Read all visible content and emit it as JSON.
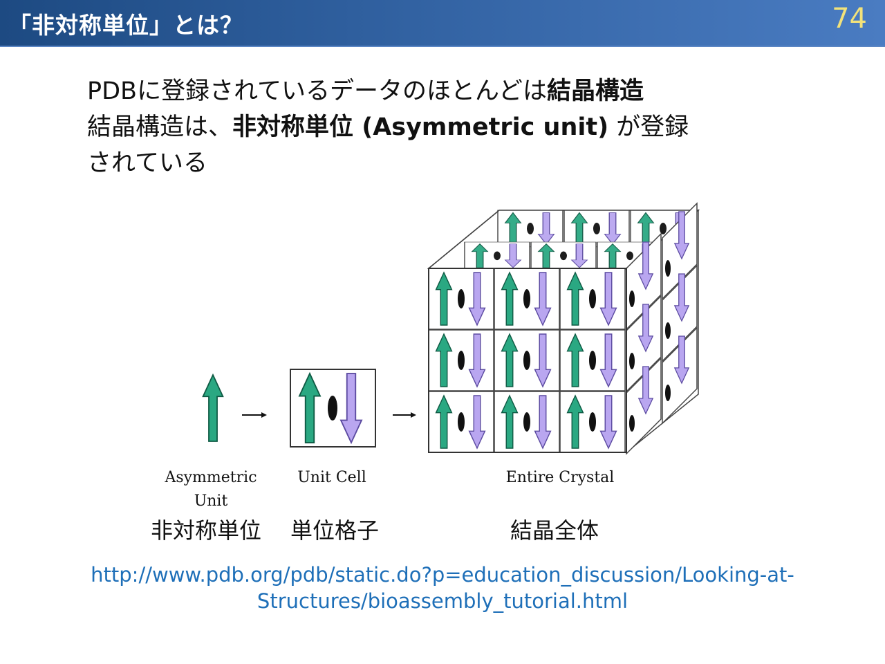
{
  "slide": {
    "title": "「非対称単位」とは？",
    "page_number": "74"
  },
  "body": {
    "line1_plain": "PDBに登録されているデータのほとんどは",
    "line1_bold": "結晶構造",
    "line2_plain": "結晶構造は、",
    "line2_bold": "非対称単位 (Asymmetric unit)",
    "line2_tail": " が登録",
    "line3": "されている"
  },
  "figure": {
    "label_asymmetric": "Asymmetric Unit",
    "label_unit_cell": "Unit Cell",
    "label_entire_crystal": "Entire Crystal",
    "jp_asymmetric": "非対称単位",
    "jp_unit_cell": "単位格子",
    "jp_entire_crystal": "結晶全体",
    "colors": {
      "green_arrow": "#2aa882",
      "purple_arrow": "#b9a6f0"
    }
  },
  "source": {
    "url_line1": "http://www.pdb.org/pdb/static.do?p=education_discussion/Looking-at-",
    "url_line2": "Structures/bioassembly_tutorial.html"
  }
}
